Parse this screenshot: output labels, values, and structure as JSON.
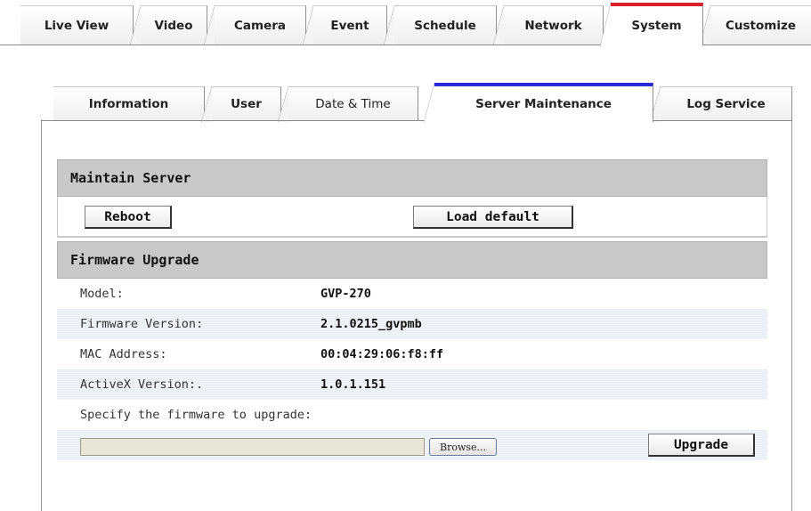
{
  "top_tabs": [
    {
      "label": "Live View"
    },
    {
      "label": "Video"
    },
    {
      "label": "Camera"
    },
    {
      "label": "Event"
    },
    {
      "label": "Schedule"
    },
    {
      "label": "Network"
    },
    {
      "label": "System",
      "active": true
    },
    {
      "label": "Customize"
    }
  ],
  "sub_tabs": [
    {
      "label": "Information"
    },
    {
      "label": "User"
    },
    {
      "label": "Date & Time"
    },
    {
      "label": "Server Maintenance",
      "active": true
    },
    {
      "label": "Log Service"
    }
  ],
  "colors": {
    "active_top_tab": "#d6202a",
    "active_sub_tab": "#2a2ad6",
    "section_header": "#c9c9c9"
  },
  "maintain_server": {
    "title": "Maintain Server",
    "reboot_label": "Reboot",
    "load_default_label": "Load default"
  },
  "firmware_upgrade": {
    "title": "Firmware Upgrade",
    "rows": [
      {
        "label": "Model:",
        "value": "GVP-270"
      },
      {
        "label": "Firmware Version:",
        "value": "2.1.0215_gvpmb"
      },
      {
        "label": "MAC Address:",
        "value": "00:04:29:06:f8:ff"
      },
      {
        "label": "ActiveX Version:.",
        "value": "1.0.1.151"
      }
    ],
    "specify_label": "Specify the firmware to upgrade:",
    "file_value": "",
    "browse_label": "Browse...",
    "upgrade_label": "Upgrade"
  }
}
